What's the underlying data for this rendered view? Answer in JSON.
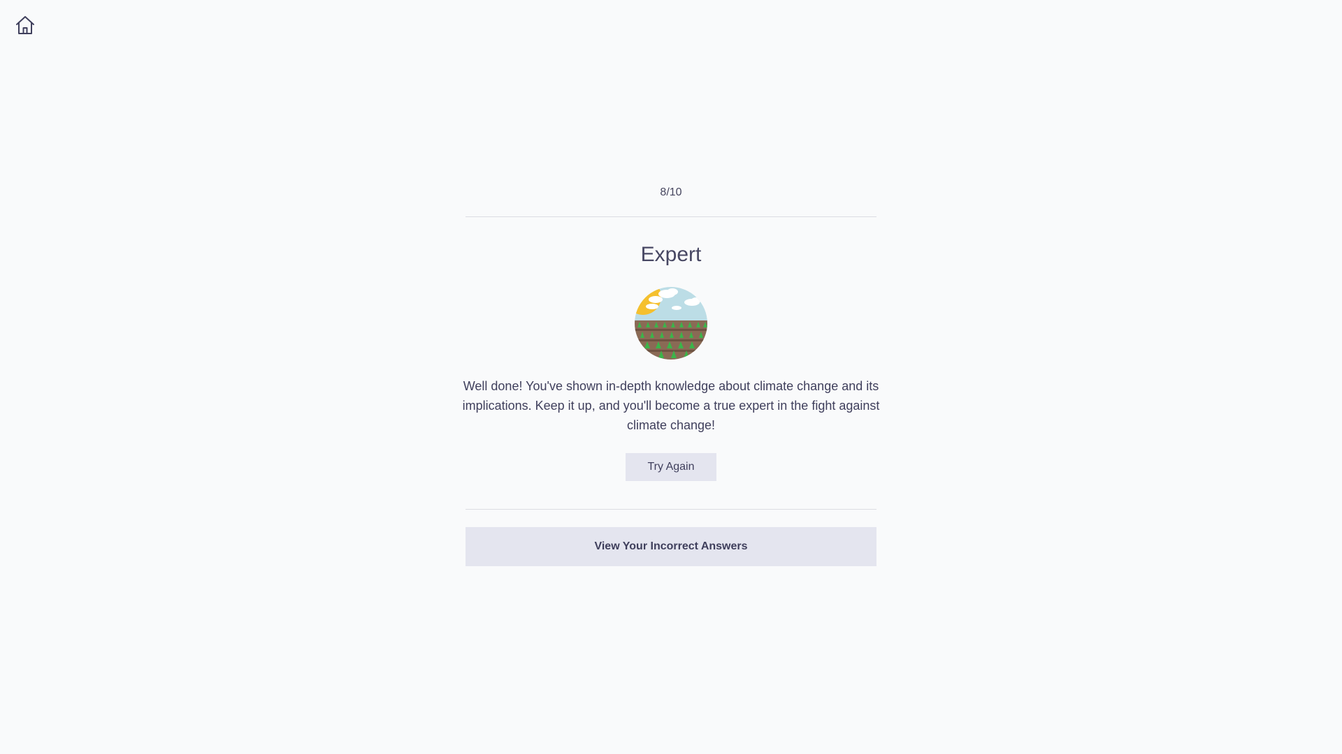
{
  "nav": {
    "home_icon": "home-icon"
  },
  "result": {
    "score": "8/10",
    "level": "Expert",
    "badge_icon": "farm-field-icon",
    "message": "Well done! You've shown in-depth knowledge about climate change and its implications. Keep it up, and you'll become a true expert in the fight against climate change!",
    "try_again_label": "Try Again",
    "view_incorrect_label": "View Your Incorrect Answers"
  },
  "colors": {
    "background": "#f9fafb",
    "button_bg": "#e4e5ef",
    "text": "#3f3f5c",
    "divider": "#dcdce2"
  }
}
